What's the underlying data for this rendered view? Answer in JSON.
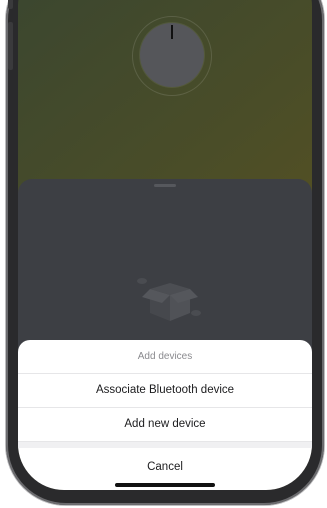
{
  "sheet": {
    "title": "Add devices",
    "items": [
      {
        "label": "Associate Bluetooth device"
      },
      {
        "label": "Add new device"
      }
    ],
    "cancel": "Cancel"
  },
  "icons": {
    "knob": "dial-knob-icon",
    "empty_state": "empty-box-illustration"
  },
  "colors": {
    "background_gradient_start": "#3a4630",
    "background_gradient_end": "#5e4f1a",
    "panel": "#3d3f44",
    "sheet": "#ffffff",
    "muted_text": "#8a8a8e",
    "text": "#1c1c1e"
  }
}
